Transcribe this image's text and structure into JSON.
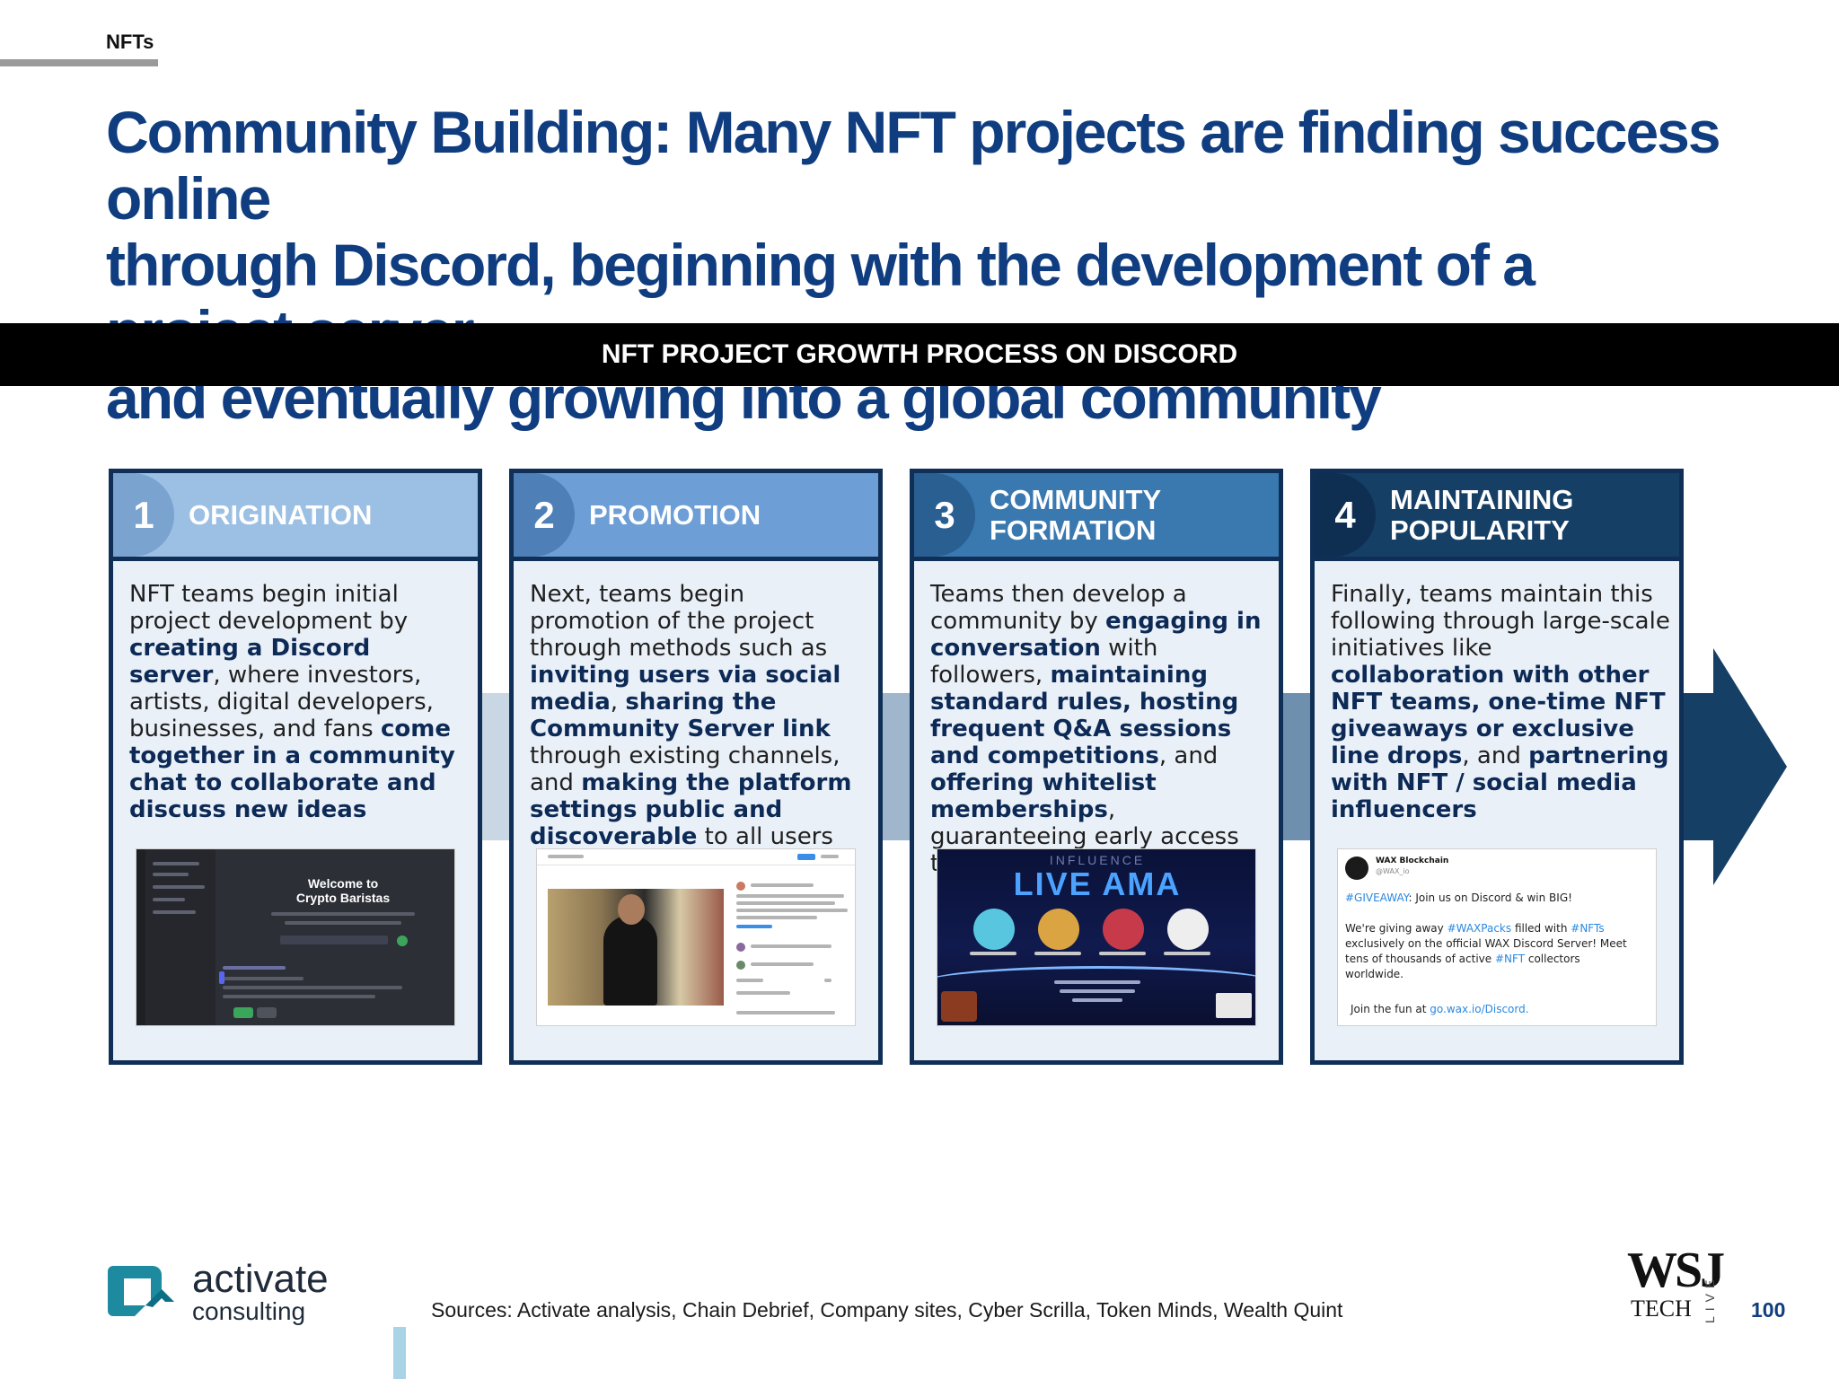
{
  "header": {
    "section_tag": "NFTs",
    "headline_1": "Community Building: Many NFT projects are finding success online",
    "headline_2": "through Discord, beginning with the development of a project server",
    "headline_3": "and eventually growing into a global community"
  },
  "banner": {
    "title": "NFT PROJECT GROWTH PROCESS ON DISCORD"
  },
  "steps": [
    {
      "number": "1",
      "title_1": "ORIGINATION",
      "color_header": "#9cbfe4",
      "color_pill": "#7aa3cf",
      "body": [
        {
          "t": "NFT teams begin initial project development by ",
          "b": false
        },
        {
          "t": "creating a Discord server",
          "b": true
        },
        {
          "t": ", where investors, artists, digital developers, businesses, and fans ",
          "b": false
        },
        {
          "t": "come together in a community chat to collaborate and discuss new ideas",
          "b": true
        }
      ],
      "screenshot": {
        "welcome_1": "Welcome to",
        "welcome_2": "Crypto Baristas"
      }
    },
    {
      "number": "2",
      "title_1": "PROMOTION",
      "color_header": "#6d9ed6",
      "color_pill": "#4f7fb7",
      "body": [
        {
          "t": "Next, teams begin promotion of the project through methods such as ",
          "b": false
        },
        {
          "t": "inviting users via social media",
          "b": true
        },
        {
          "t": ", ",
          "b": false
        },
        {
          "t": "sharing the Community Server link",
          "b": true
        },
        {
          "t": " through existing channels, and ",
          "b": false
        },
        {
          "t": "making the platform settings public and discoverable",
          "b": true
        },
        {
          "t": " to all users",
          "b": false
        }
      ]
    },
    {
      "number": "3",
      "title_1": "COMMUNITY",
      "title_2": "FORMATION",
      "color_header": "#3a78b0",
      "color_pill": "#2a5f92",
      "body": [
        {
          "t": "Teams then develop a community by ",
          "b": false
        },
        {
          "t": "engaging in conversation",
          "b": true
        },
        {
          "t": " with followers, ",
          "b": false
        },
        {
          "t": "maintaining standard rules, hosting frequent Q&A sessions and competitions",
          "b": true
        },
        {
          "t": ", and ",
          "b": false
        },
        {
          "t": "offering whitelist memberships",
          "b": true
        },
        {
          "t": ", guaranteeing early access to NFT minting",
          "b": false
        }
      ],
      "screenshot": {
        "small": "INFLUENCE",
        "title": "LIVE AMA"
      }
    },
    {
      "number": "4",
      "title_1": "MAINTAINING",
      "title_2": "POPULARITY",
      "color_header": "#163f66",
      "color_pill": "#0f2f52",
      "body": [
        {
          "t": "Finally, teams maintain this following through large-scale initiatives like ",
          "b": false
        },
        {
          "t": "collaboration with other NFT teams, one-time NFT giveaways or exclusive line drops",
          "b": true
        },
        {
          "t": ", and ",
          "b": false
        },
        {
          "t": "partnering with NFT / social media influencers",
          "b": true
        }
      ],
      "screenshot": {
        "name": "WAX Blockchain",
        "handle": "@WAX_io",
        "line1_tag": "#GIVEAWAY",
        "line1": ": Join us on Discord & win BIG!",
        "line2a": "We're giving away ",
        "line2_tag": "#WAXPacks",
        "line2b": " filled with ",
        "line2_tag2": "#NFTs",
        "line3": "exclusively on the official WAX Discord Server! Meet",
        "line4a": "tens of thousands of active ",
        "line4_tag": "#NFT",
        "line4b": " collectors",
        "line5": "worldwide.",
        "line6a": "Join the fun at ",
        "line6_link": "go.wax.io/Discord."
      }
    }
  ],
  "footer": {
    "logo_main": "activate",
    "logo_sub": "consulting",
    "sources": "Sources: Activate analysis, Chain Debrief, Company sites, Cyber Scrilla, Token Minds, Wealth Quint",
    "wsj": "WSJ",
    "tech": "TECH",
    "live": "LIVE",
    "page": "100"
  },
  "colors": {
    "headline": "#0f3d80",
    "card_border": "#0f2f56",
    "card_bg": "#eaf0f8",
    "arrow": [
      "#c9d6e3",
      "#9fb6cc",
      "#6f8fae",
      "#163f66"
    ]
  }
}
